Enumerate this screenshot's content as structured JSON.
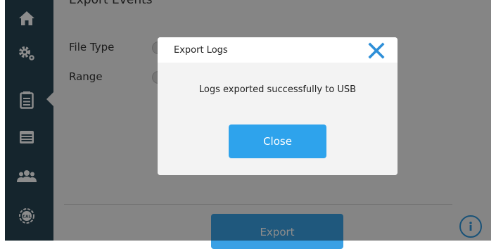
{
  "page": {
    "heading": "Export Events",
    "form": {
      "file_type_label": "File Type",
      "range_label": "Range"
    },
    "export_label": "Export"
  },
  "sidebar": {
    "items": [
      {
        "icon": "home-icon",
        "active": false
      },
      {
        "icon": "settings-gears-icon",
        "active": false
      },
      {
        "icon": "clipboard-icon",
        "active": true
      },
      {
        "icon": "calendar-list-icon",
        "active": false
      },
      {
        "icon": "users-icon",
        "active": false
      },
      {
        "icon": "calibration-icon",
        "active": false,
        "badge_text": "CAL"
      }
    ]
  },
  "dialog": {
    "title": "Export Logs",
    "message": "Logs exported successfully to USB",
    "close_label": "Close"
  },
  "colors": {
    "sidebar_bg": "#274453",
    "accent_blue": "#2ea3ec",
    "icon_color": "#ffffff"
  }
}
